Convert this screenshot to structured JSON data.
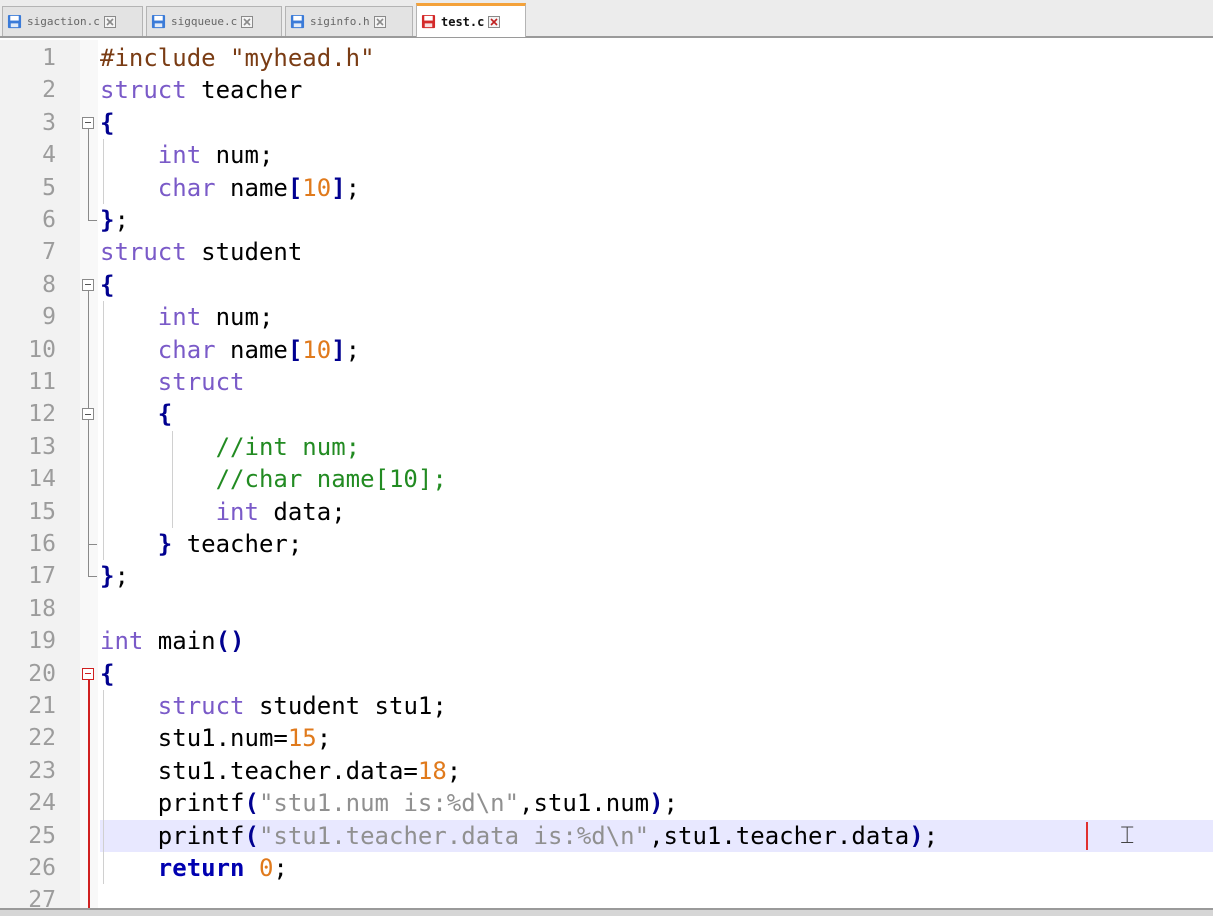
{
  "tabs": [
    {
      "label": "sigaction.c",
      "state": "saved",
      "active": false
    },
    {
      "label": "sigqueue.c",
      "state": "saved",
      "active": false
    },
    {
      "label": "siginfo.h",
      "state": "saved",
      "active": false
    },
    {
      "label": "test.c",
      "state": "modified",
      "active": true
    }
  ],
  "icons": {
    "tab_saved": "floppy-disk-blue-icon",
    "tab_modified": "floppy-disk-red-icon",
    "tab_close": "close-x-icon",
    "cursor": "i-beam-cursor-icon"
  },
  "colors": {
    "keyword": "#7a5ac8",
    "return_keyword": "#0000b0",
    "number": "#e07a1c",
    "string": "#909090",
    "comment": "#228b22",
    "preprocessor": "#7a3c14",
    "current_line": "#e8e8ff",
    "active_tab_accent": "#f4a23a"
  },
  "editor": {
    "current_line": 25,
    "lines": [
      {
        "n": "1",
        "tokens": [
          {
            "t": "#include \"myhead.h\"",
            "c": "pp"
          }
        ]
      },
      {
        "n": "2",
        "tokens": [
          {
            "t": "struct",
            "c": "kw"
          },
          {
            "t": " teacher",
            "c": "id"
          }
        ]
      },
      {
        "n": "3",
        "tokens": [
          {
            "t": "{",
            "c": "op"
          }
        ]
      },
      {
        "n": "4",
        "tokens": [
          {
            "t": "    ",
            "c": "id"
          },
          {
            "t": "int",
            "c": "kw"
          },
          {
            "t": " num",
            "c": "id"
          },
          {
            "t": ";",
            "c": "pu"
          }
        ]
      },
      {
        "n": "5",
        "tokens": [
          {
            "t": "    ",
            "c": "id"
          },
          {
            "t": "char",
            "c": "kw"
          },
          {
            "t": " name",
            "c": "id"
          },
          {
            "t": "[",
            "c": "op"
          },
          {
            "t": "10",
            "c": "num"
          },
          {
            "t": "]",
            "c": "op"
          },
          {
            "t": ";",
            "c": "pu"
          }
        ]
      },
      {
        "n": "6",
        "tokens": [
          {
            "t": "}",
            "c": "op"
          },
          {
            "t": ";",
            "c": "pu"
          }
        ]
      },
      {
        "n": "7",
        "tokens": [
          {
            "t": "struct",
            "c": "kw"
          },
          {
            "t": " student",
            "c": "id"
          }
        ]
      },
      {
        "n": "8",
        "tokens": [
          {
            "t": "{",
            "c": "op"
          }
        ]
      },
      {
        "n": "9",
        "tokens": [
          {
            "t": "    ",
            "c": "id"
          },
          {
            "t": "int",
            "c": "kw"
          },
          {
            "t": " num",
            "c": "id"
          },
          {
            "t": ";",
            "c": "pu"
          }
        ]
      },
      {
        "n": "10",
        "tokens": [
          {
            "t": "    ",
            "c": "id"
          },
          {
            "t": "char",
            "c": "kw"
          },
          {
            "t": " name",
            "c": "id"
          },
          {
            "t": "[",
            "c": "op"
          },
          {
            "t": "10",
            "c": "num"
          },
          {
            "t": "]",
            "c": "op"
          },
          {
            "t": ";",
            "c": "pu"
          }
        ]
      },
      {
        "n": "11",
        "tokens": [
          {
            "t": "    ",
            "c": "id"
          },
          {
            "t": "struct",
            "c": "kw"
          }
        ]
      },
      {
        "n": "12",
        "tokens": [
          {
            "t": "    ",
            "c": "id"
          },
          {
            "t": "{",
            "c": "op"
          }
        ]
      },
      {
        "n": "13",
        "tokens": [
          {
            "t": "        ",
            "c": "id"
          },
          {
            "t": "//int num;",
            "c": "cm"
          }
        ]
      },
      {
        "n": "14",
        "tokens": [
          {
            "t": "        ",
            "c": "id"
          },
          {
            "t": "//char name[10];",
            "c": "cm"
          }
        ]
      },
      {
        "n": "15",
        "tokens": [
          {
            "t": "        ",
            "c": "id"
          },
          {
            "t": "int",
            "c": "kw"
          },
          {
            "t": " data",
            "c": "id"
          },
          {
            "t": ";",
            "c": "pu"
          }
        ]
      },
      {
        "n": "16",
        "tokens": [
          {
            "t": "    ",
            "c": "id"
          },
          {
            "t": "}",
            "c": "op"
          },
          {
            "t": " teacher",
            "c": "id"
          },
          {
            "t": ";",
            "c": "pu"
          }
        ]
      },
      {
        "n": "17",
        "tokens": [
          {
            "t": "}",
            "c": "op"
          },
          {
            "t": ";",
            "c": "pu"
          }
        ]
      },
      {
        "n": "18",
        "tokens": []
      },
      {
        "n": "19",
        "tokens": [
          {
            "t": "int",
            "c": "kw"
          },
          {
            "t": " main",
            "c": "id"
          },
          {
            "t": "()",
            "c": "op"
          }
        ]
      },
      {
        "n": "20",
        "tokens": [
          {
            "t": "{",
            "c": "op"
          }
        ]
      },
      {
        "n": "21",
        "tokens": [
          {
            "t": "    ",
            "c": "id"
          },
          {
            "t": "struct",
            "c": "kw"
          },
          {
            "t": " student stu1",
            "c": "id"
          },
          {
            "t": ";",
            "c": "pu"
          }
        ]
      },
      {
        "n": "22",
        "tokens": [
          {
            "t": "    ",
            "c": "id"
          },
          {
            "t": "stu1.num=",
            "c": "id"
          },
          {
            "t": "15",
            "c": "num"
          },
          {
            "t": ";",
            "c": "pu"
          }
        ]
      },
      {
        "n": "23",
        "tokens": [
          {
            "t": "    ",
            "c": "id"
          },
          {
            "t": "stu1.teacher.data=",
            "c": "id"
          },
          {
            "t": "18",
            "c": "num"
          },
          {
            "t": ";",
            "c": "pu"
          }
        ]
      },
      {
        "n": "24",
        "tokens": [
          {
            "t": "    ",
            "c": "id"
          },
          {
            "t": "printf",
            "c": "id"
          },
          {
            "t": "(",
            "c": "op"
          },
          {
            "t": "\"stu1.num is:%d\\n\"",
            "c": "str"
          },
          {
            "t": ",stu1.num",
            "c": "id"
          },
          {
            "t": ")",
            "c": "op"
          },
          {
            "t": ";",
            "c": "pu"
          }
        ]
      },
      {
        "n": "25",
        "tokens": [
          {
            "t": "    ",
            "c": "id"
          },
          {
            "t": "printf",
            "c": "id"
          },
          {
            "t": "(",
            "c": "op"
          },
          {
            "t": "\"stu1.teacher.data is:%d\\n\"",
            "c": "str"
          },
          {
            "t": ",stu1.teacher.data",
            "c": "id"
          },
          {
            "t": ")",
            "c": "op"
          },
          {
            "t": ";",
            "c": "pu"
          }
        ]
      },
      {
        "n": "26",
        "tokens": [
          {
            "t": "    ",
            "c": "id"
          },
          {
            "t": "return",
            "c": "kb"
          },
          {
            "t": " ",
            "c": "id"
          },
          {
            "t": "0",
            "c": "num"
          },
          {
            "t": ";",
            "c": "pu"
          }
        ]
      },
      {
        "n": "27",
        "tokens": []
      }
    ]
  }
}
